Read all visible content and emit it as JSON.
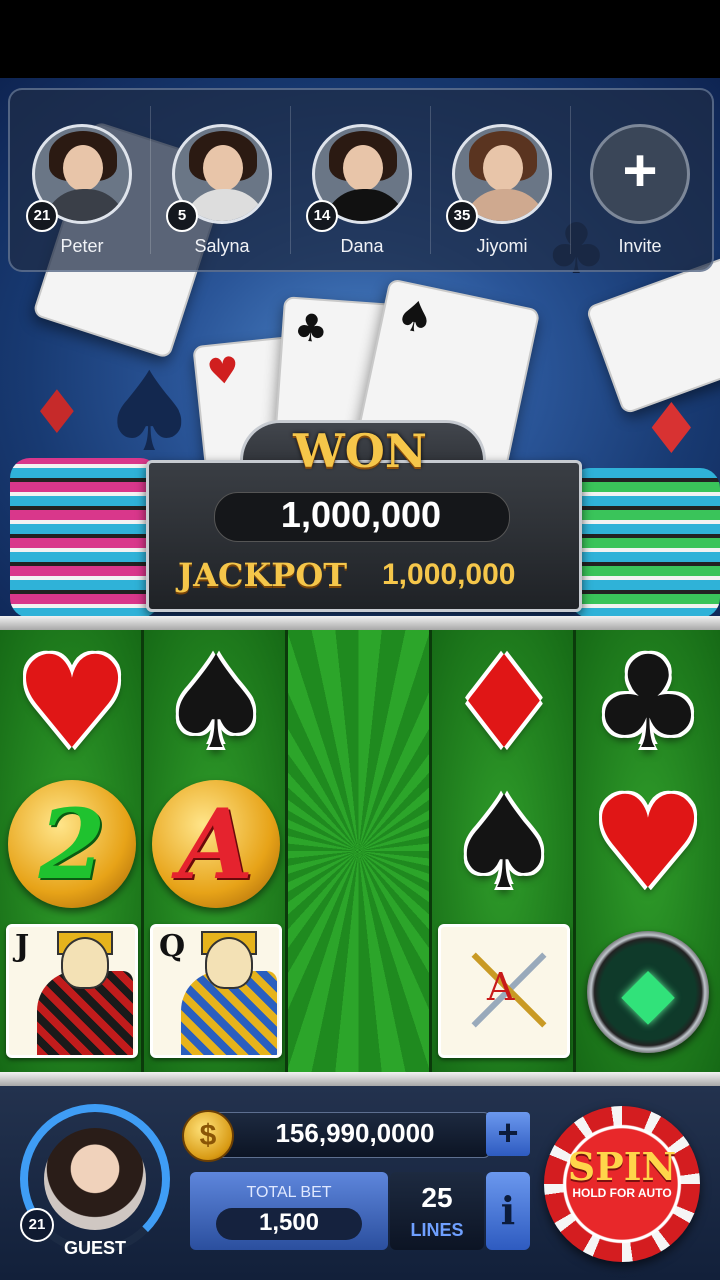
{
  "friends": [
    {
      "name": "Peter",
      "level": "21"
    },
    {
      "name": "Salyna",
      "level": "5"
    },
    {
      "name": "Dana",
      "level": "14"
    },
    {
      "name": "Jiyomi",
      "level": "35"
    }
  ],
  "invite": {
    "label": "Invite"
  },
  "won_panel": {
    "title": "WON",
    "amount": "1,000,000",
    "jackpot_label": "JACKPOT",
    "jackpot_value": "1,000,000"
  },
  "reels": [
    [
      "heart",
      "coin-2",
      "jack-card"
    ],
    [
      "spade",
      "coin-A",
      "queen-card"
    ],
    [],
    [
      "diamond",
      "spade",
      "ace-card"
    ],
    [
      "club",
      "heart",
      "emerald-gem"
    ]
  ],
  "coin_letters": {
    "coin2": "2",
    "coinA": "A"
  },
  "card_ranks": {
    "jack": "J",
    "queen": "Q",
    "ace": "A"
  },
  "player": {
    "level": "21",
    "name": "GUEST"
  },
  "balance": "156,990,0000",
  "total_bet": {
    "label": "TOTAL BET",
    "value": "1,500"
  },
  "lines": {
    "value": "25",
    "label": "LINES"
  },
  "spin": {
    "label": "SPIN",
    "sub": "HOLD FOR AUTO"
  },
  "colors": {
    "felt": "#1b6e1b",
    "gold": "#f5c64a",
    "spin_red": "#e8282a",
    "accent_blue": "#3f9df5"
  }
}
